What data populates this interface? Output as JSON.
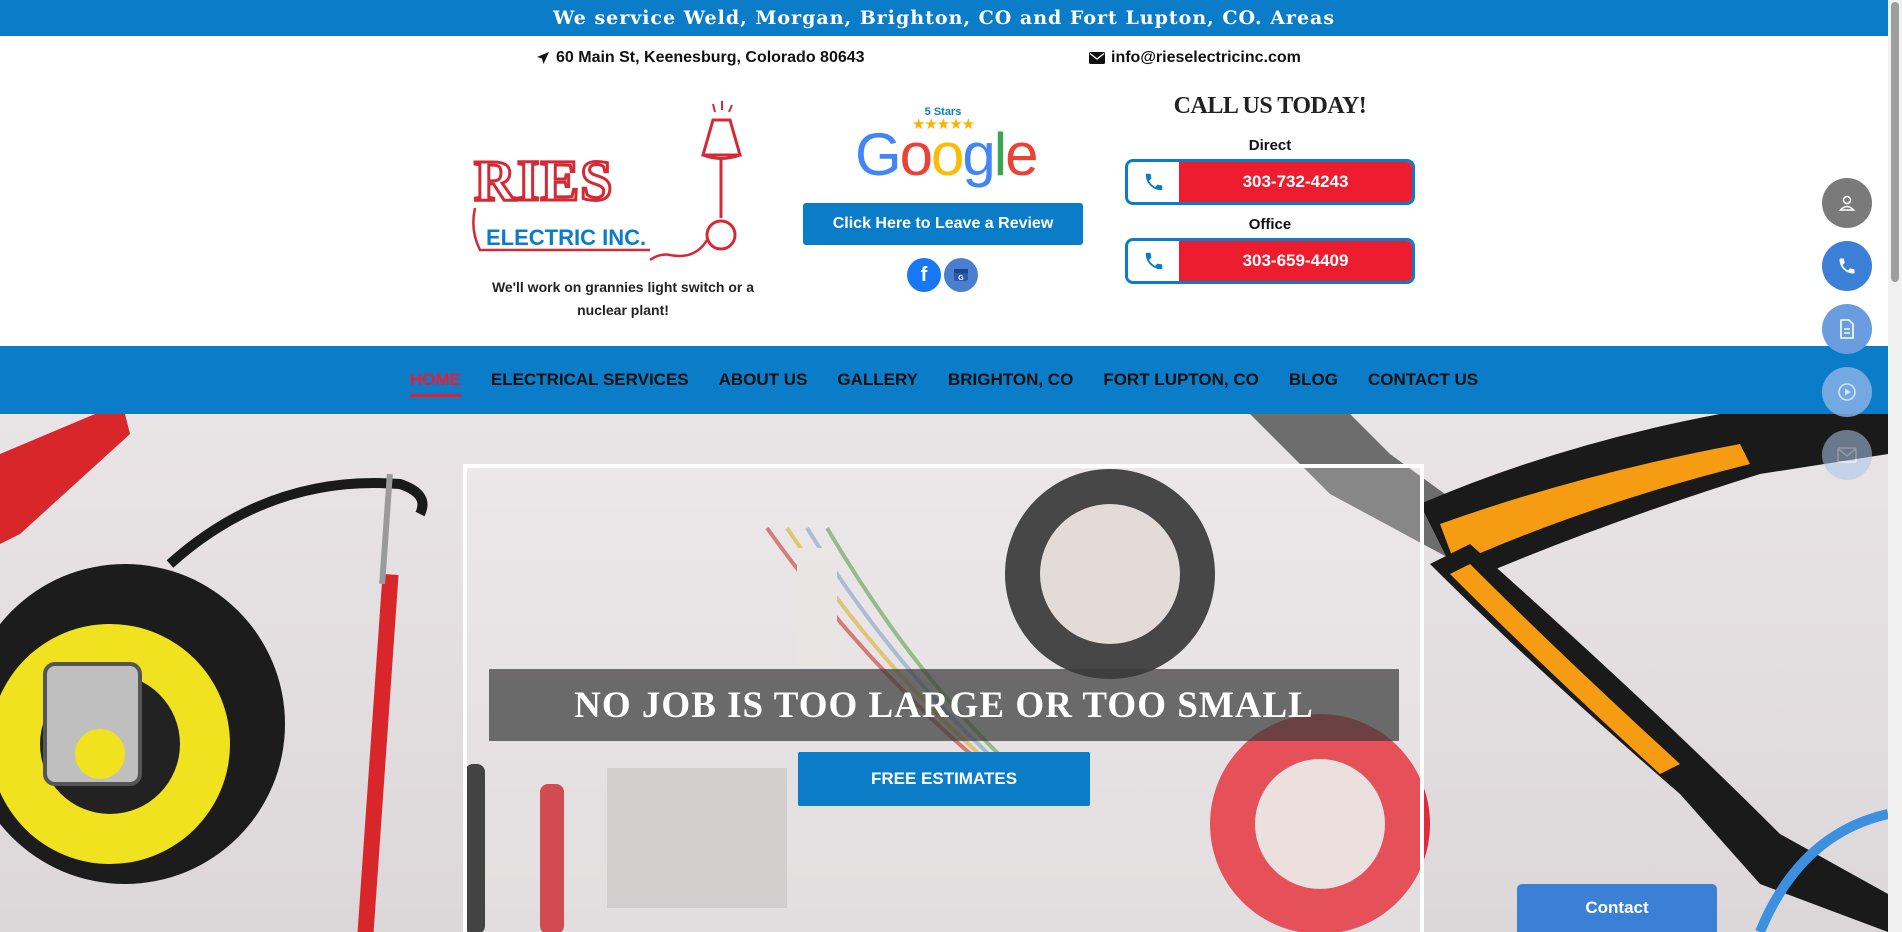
{
  "top_banner": {
    "text": "We service Weld, Morgan, Brighton, CO and Fort Lupton, CO. Areas"
  },
  "header": {
    "address": "60 Main St, Keenesburg, Colorado 80643",
    "email": "info@rieselectricinc.com",
    "logo": {
      "line1": "RIES",
      "line2": "ELECTRIC INC."
    },
    "tagline": "We'll work on grannies light switch or a nuclear plant!",
    "google_badge": {
      "stars_label": "5 Stars",
      "stars": "★★★★★",
      "word": "Google"
    },
    "review_button": "Click Here to Leave a Review",
    "call_title": "CALL US TODAY!",
    "phones": [
      {
        "label": "Direct",
        "number": "303-732-4243"
      },
      {
        "label": "Office",
        "number": "303-659-4409"
      }
    ]
  },
  "nav": {
    "items": [
      {
        "label": "HOME",
        "active": true
      },
      {
        "label": "ELECTRICAL SERVICES"
      },
      {
        "label": "ABOUT US"
      },
      {
        "label": "GALLERY"
      },
      {
        "label": "BRIGHTON, CO"
      },
      {
        "label": "FORT LUPTON, CO"
      },
      {
        "label": "BLOG"
      },
      {
        "label": "CONTACT US"
      }
    ]
  },
  "hero": {
    "heading": "NO JOB IS TOO LARGE OR TOO SMALL",
    "button": "FREE ESTIMATES"
  },
  "floating_actions": [
    "person-icon",
    "phone-icon",
    "document-icon",
    "play-icon",
    "mail-icon"
  ],
  "contact_widget": {
    "label": "Contact"
  },
  "colors": {
    "brand_blue": "#0a7cc8",
    "brand_red": "#ed1c2e",
    "float_gray": "#7a7a7a",
    "float_blue": "#3b7fd6"
  }
}
